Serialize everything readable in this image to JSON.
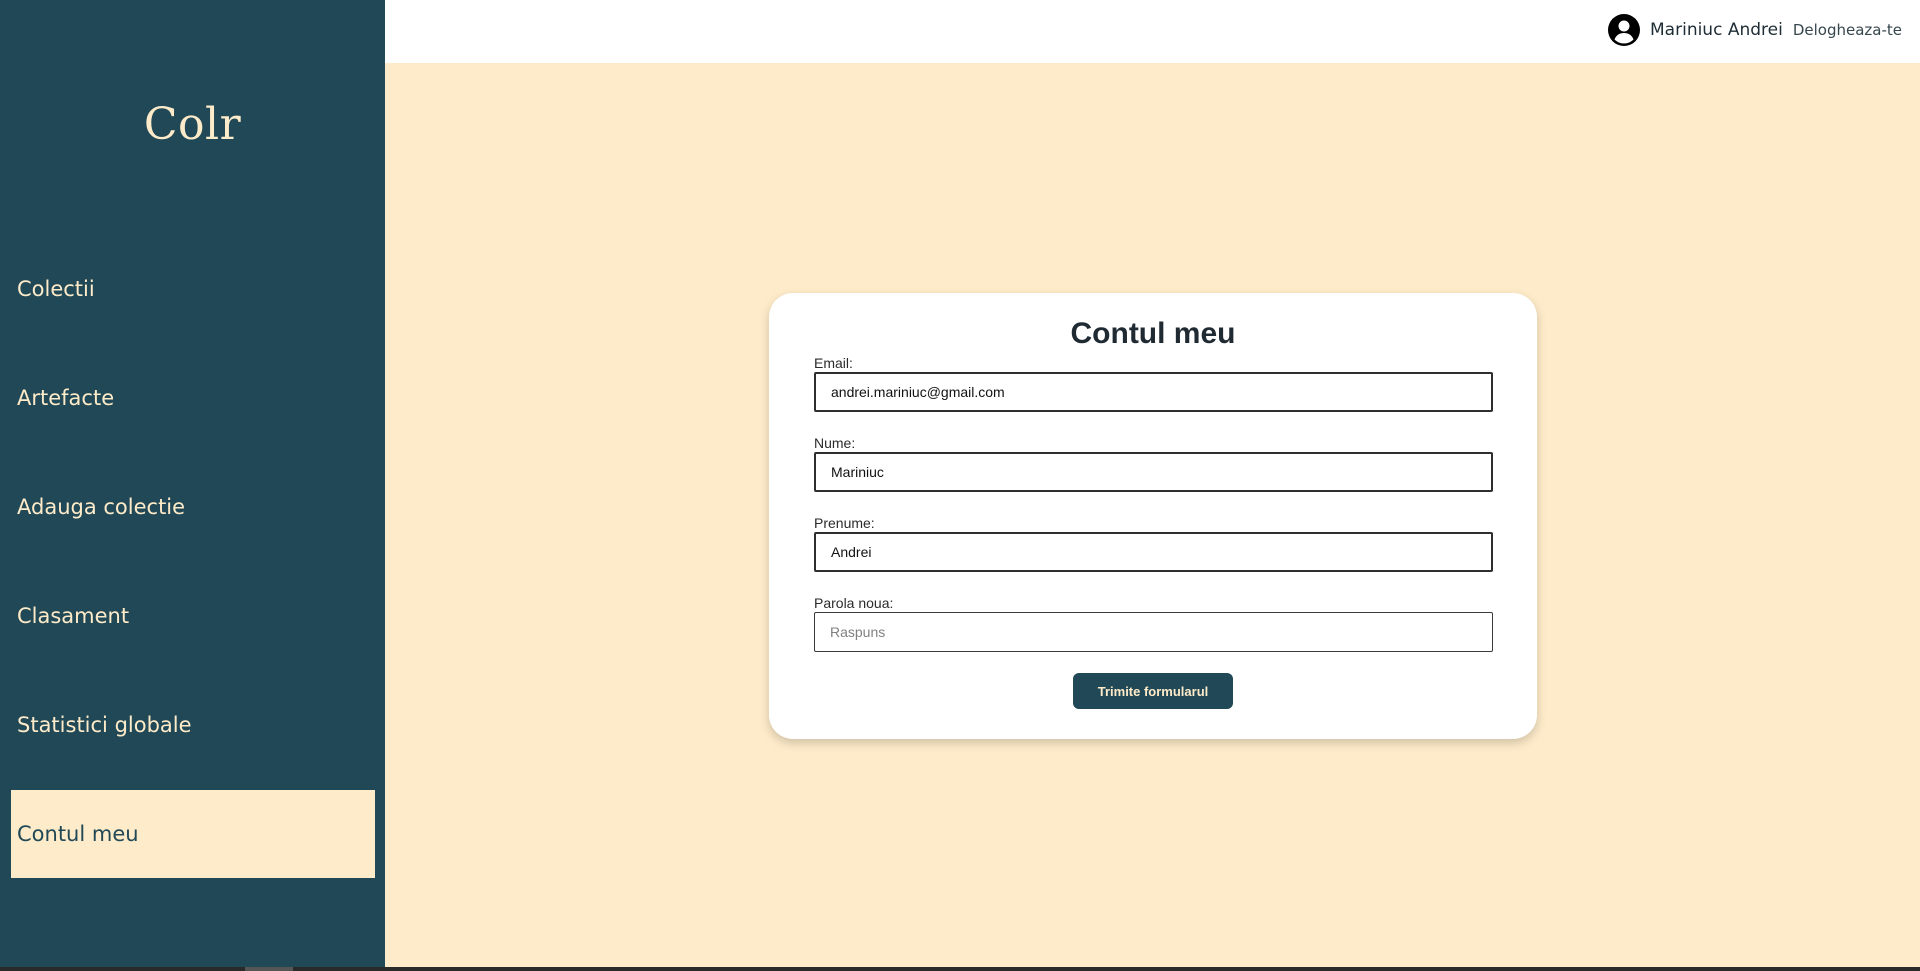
{
  "app": {
    "logo": "Colr"
  },
  "sidebar": {
    "items": [
      {
        "label": "Colectii",
        "active": false
      },
      {
        "label": "Artefacte",
        "active": false
      },
      {
        "label": "Adauga colectie",
        "active": false
      },
      {
        "label": "Clasament",
        "active": false
      },
      {
        "label": "Statistici globale",
        "active": false
      },
      {
        "label": "Contul meu",
        "active": true
      }
    ]
  },
  "header": {
    "user_icon": "account-circle-icon",
    "user_name": "Mariniuc Andrei",
    "logout_label": "Delogheaza-te"
  },
  "form": {
    "title": "Contul meu",
    "email": {
      "label": "Email:",
      "value": "andrei.mariniuc@gmail.com"
    },
    "last_name": {
      "label": "Nume:",
      "value": "Mariniuc"
    },
    "first_name": {
      "label": "Prenume:",
      "value": "Andrei"
    },
    "new_password": {
      "label": "Parola noua:",
      "value": "",
      "placeholder": "Raspuns"
    },
    "submit_label": "Trimite formularul"
  },
  "colors": {
    "primary": "#214856",
    "accent": "#fdebc9",
    "background": "#fdebc9",
    "card": "#ffffff"
  }
}
